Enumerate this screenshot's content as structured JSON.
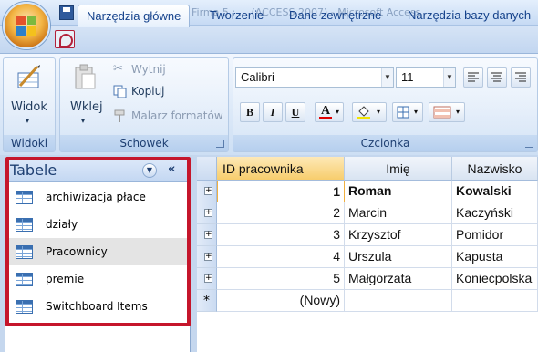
{
  "title_bar": {
    "document_title": "Firma 5 : ... (ACCESS 2007) - Microsoft Access"
  },
  "tabs": [
    {
      "label": "Narzędzia główne",
      "active": true
    },
    {
      "label": "Tworzenie",
      "active": false
    },
    {
      "label": "Dane zewnętrzne",
      "active": false
    },
    {
      "label": "Narzędzia bazy danych",
      "active": false
    }
  ],
  "ribbon": {
    "views": {
      "button_label": "Widok",
      "group_label": "Widoki"
    },
    "clipboard": {
      "paste_label": "Wklej",
      "cut_label": "Wytnij",
      "copy_label": "Kopiuj",
      "format_painter_label": "Malarz formatów",
      "group_label": "Schowek"
    },
    "font": {
      "font_name": "Calibri",
      "font_size": "11",
      "bold": "B",
      "italic": "I",
      "underline": "U",
      "font_color_letter": "A",
      "group_label": "Czcionka"
    }
  },
  "nav_pane": {
    "title": "Tabele",
    "items": [
      {
        "label": "archiwizacja płace",
        "selected": false
      },
      {
        "label": "działy",
        "selected": false
      },
      {
        "label": "Pracownicy",
        "selected": true
      },
      {
        "label": "premie",
        "selected": false
      },
      {
        "label": "Switchboard Items",
        "selected": false
      }
    ]
  },
  "datasheet": {
    "columns": [
      "ID pracownika",
      "Imię",
      "Nazwisko"
    ],
    "rows": [
      {
        "id": "1",
        "first": "Roman",
        "last": "Kowalski"
      },
      {
        "id": "2",
        "first": "Marcin",
        "last": "Kaczyński"
      },
      {
        "id": "3",
        "first": "Krzysztof",
        "last": "Pomidor"
      },
      {
        "id": "4",
        "first": "Urszula",
        "last": "Kapusta"
      },
      {
        "id": "5",
        "first": "Małgorzata",
        "last": "Koniecpolska"
      }
    ],
    "new_record_label": "(Nowy)",
    "new_record_marker": "*"
  },
  "colors": {
    "highlight_border": "#c5162b",
    "active_column_header": "#f7cd6c"
  }
}
